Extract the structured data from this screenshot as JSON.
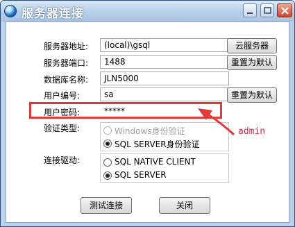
{
  "window": {
    "title": "服务器连接",
    "icon": "globe-icon",
    "controls": {
      "minimize": "minimize-icon",
      "maximize": "maximize-icon",
      "close": "close-icon"
    }
  },
  "form": {
    "server_address": {
      "label": "服务器地址:",
      "value": "(local)\\gsql"
    },
    "server_port": {
      "label": "服务器端口:",
      "value": "1488"
    },
    "database_name": {
      "label": "数据库名称:",
      "value": "JLN5000"
    },
    "user_id": {
      "label": "用户编号:",
      "value": "sa"
    },
    "password": {
      "label": "用户密码:",
      "value": "*****"
    },
    "auth_type": {
      "label": "验证类型:",
      "options": [
        {
          "label": "Windows身份验证",
          "selected": false,
          "enabled": false
        },
        {
          "label": "SQL SERVER身份验证",
          "selected": true,
          "enabled": true
        }
      ]
    },
    "driver": {
      "label": "连接驱动:",
      "options": [
        {
          "label": "SQL NATIVE CLIENT",
          "selected": false,
          "enabled": true
        },
        {
          "label": "SQL SERVER",
          "selected": true,
          "enabled": true
        }
      ]
    }
  },
  "buttons": {
    "cloud_server": "云服务器",
    "reset_default_1": "重置为默认",
    "reset_default_2": "重置为默认",
    "test_connection": "测试连接",
    "close": "关闭"
  },
  "annotation": {
    "text": "admin",
    "color": "#c0344b",
    "highlight_color": "#e03a3a"
  }
}
